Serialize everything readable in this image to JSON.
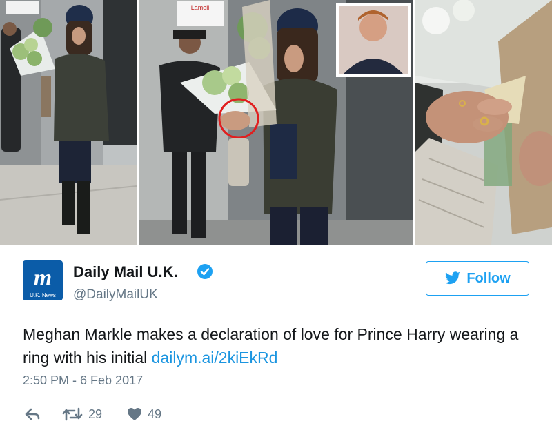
{
  "photos": {
    "panel_1": {
      "shop_sign": ""
    },
    "panel_2": {
      "shop_sign": "Lamoli"
    },
    "panel_3": {}
  },
  "tweet": {
    "author": {
      "display_name": "Daily Mail U.K.",
      "handle": "@DailyMailUK",
      "avatar_badge_text": "U.K. News",
      "verified": true
    },
    "follow_label": "Follow",
    "text_main": "Meghan Markle makes a declaration of love for Prince Harry wearing a ring with his initial",
    "link_text": "dailym.ai/2kiEkRd",
    "timestamp": "2:50 PM - 6 Feb 2017",
    "stats": {
      "retweets": "29",
      "likes": "49"
    }
  },
  "colors": {
    "twitter_blue": "#1da1f2",
    "link_blue": "#1b95e0",
    "gray_text": "#657786",
    "daily_mail_blue": "#0b5ca8"
  },
  "icons": [
    "reply-icon",
    "retweet-icon",
    "heart-icon",
    "verified-icon",
    "twitter-bird-icon"
  ]
}
